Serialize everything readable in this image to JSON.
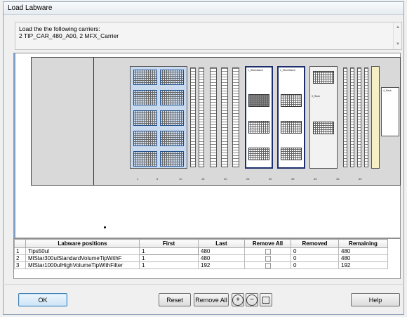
{
  "window": {
    "title": "Load Labware"
  },
  "message": {
    "lines": [
      "Load the the following carriers:",
      "2 TIP_CAR_480_A00, 2 MFX_Carrier"
    ]
  },
  "deck": {
    "labels": [
      "1_tRackName",
      "2_tRackName",
      "3_Rack",
      "4_Rack"
    ],
    "tick_labels": [
      "1",
      "5",
      "10",
      "15",
      "20",
      "25",
      "30",
      "35",
      "40",
      "45",
      "50"
    ]
  },
  "grid": {
    "columns": [
      "",
      "Labware positions",
      "First",
      "Last",
      "Remove All",
      "Removed",
      "Remaining"
    ],
    "rows": [
      {
        "index": "1",
        "name": "Tips50ul",
        "first": "1",
        "last": "480",
        "removed": "0",
        "remaining": "480"
      },
      {
        "index": "2",
        "name": "MlStar300ulStandardVolumeTipWithF",
        "first": "1",
        "last": "480",
        "removed": "0",
        "remaining": "480"
      },
      {
        "index": "3",
        "name": "MlStar1000ulHighVolumeTipWithFilter",
        "first": "1",
        "last": "192",
        "removed": "0",
        "remaining": "192"
      }
    ]
  },
  "buttons": {
    "ok": "OK",
    "reset": "Reset",
    "remove_all": "Remove All",
    "help": "Help"
  },
  "icons": {
    "zoom_in": "zoom-in-icon",
    "zoom_out": "zoom-out-icon",
    "fit": "fit-view-icon"
  }
}
